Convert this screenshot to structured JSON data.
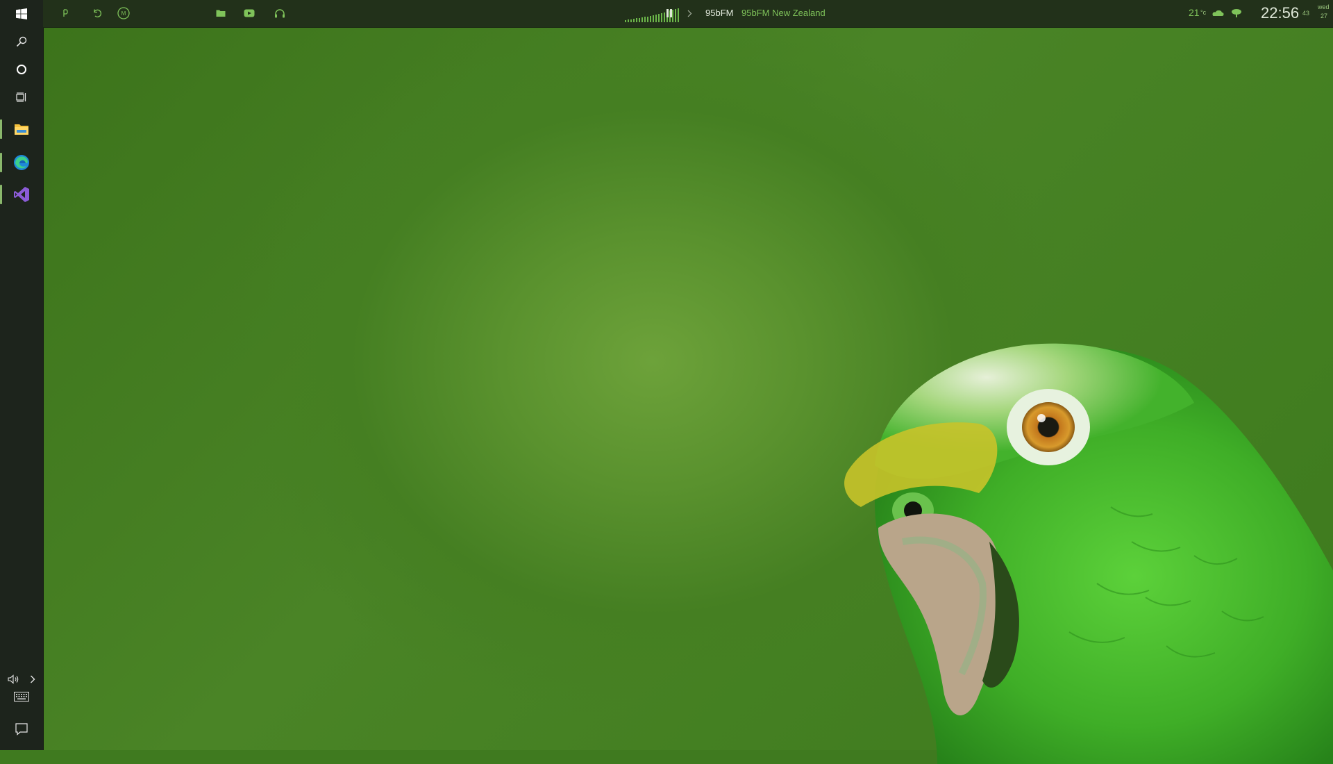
{
  "colors": {
    "accent_green": "#7fc35a",
    "sidebar_bg": "#1d241c",
    "topbar_bg": "#22311a",
    "wallpaper_center": "#6da23a",
    "wallpaper_edge": "#3b721a"
  },
  "sidebar": {
    "items": [
      {
        "name": "start",
        "icon": "windows-logo-icon"
      },
      {
        "name": "search",
        "icon": "search-icon"
      },
      {
        "name": "cortana",
        "icon": "circle-icon"
      },
      {
        "name": "task-view",
        "icon": "task-view-icon"
      },
      {
        "name": "file-explorer",
        "icon": "folder-icon",
        "running": true
      },
      {
        "name": "edge",
        "icon": "edge-icon",
        "running": true
      },
      {
        "name": "visual-studio",
        "icon": "visual-studio-icon",
        "running": true
      }
    ],
    "tray": [
      {
        "name": "volume",
        "icon": "speaker-icon"
      },
      {
        "name": "show-hidden",
        "icon": "chevron-right-icon"
      },
      {
        "name": "keyboard",
        "icon": "keyboard-icon"
      },
      {
        "name": "notifications",
        "icon": "chat-bubble-icon"
      }
    ]
  },
  "topbar": {
    "left_icons": [
      "power-icon",
      "restart-icon",
      "sleep-icon"
    ],
    "quick_icons": [
      "folder-icon",
      "youtube-icon",
      "headphones-icon"
    ],
    "player": {
      "station_short": "95bFM",
      "station_full": "95bFM New Zealand",
      "state": "playing"
    },
    "weather": {
      "temperature": "21",
      "unit": "°c",
      "icons": [
        "cloud-icon",
        "tree-icon"
      ]
    },
    "clock": {
      "time": "22:56",
      "seconds": "43",
      "day": "wed",
      "date": "27"
    }
  }
}
